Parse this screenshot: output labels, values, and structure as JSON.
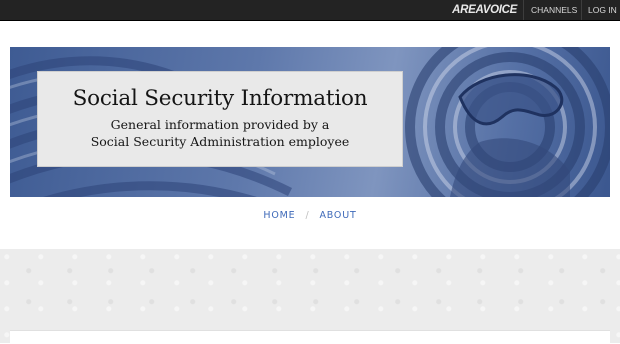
{
  "topbar": {
    "brand": "AREAVOICE",
    "nav": [
      "CHANNELS",
      "LOG IN"
    ]
  },
  "header": {
    "site_title": "Social Security Information",
    "subtitle_line1": "General information provided by a",
    "subtitle_line2": "Social Security Administration employee"
  },
  "main_nav": {
    "items": [
      "HOME",
      "ABOUT"
    ],
    "separator": "/"
  },
  "colors": {
    "topbar_bg": "#232323",
    "banner_blue": "#5e78ab",
    "nav_link": "#3f6ab9",
    "page_bg": "#ececec"
  }
}
